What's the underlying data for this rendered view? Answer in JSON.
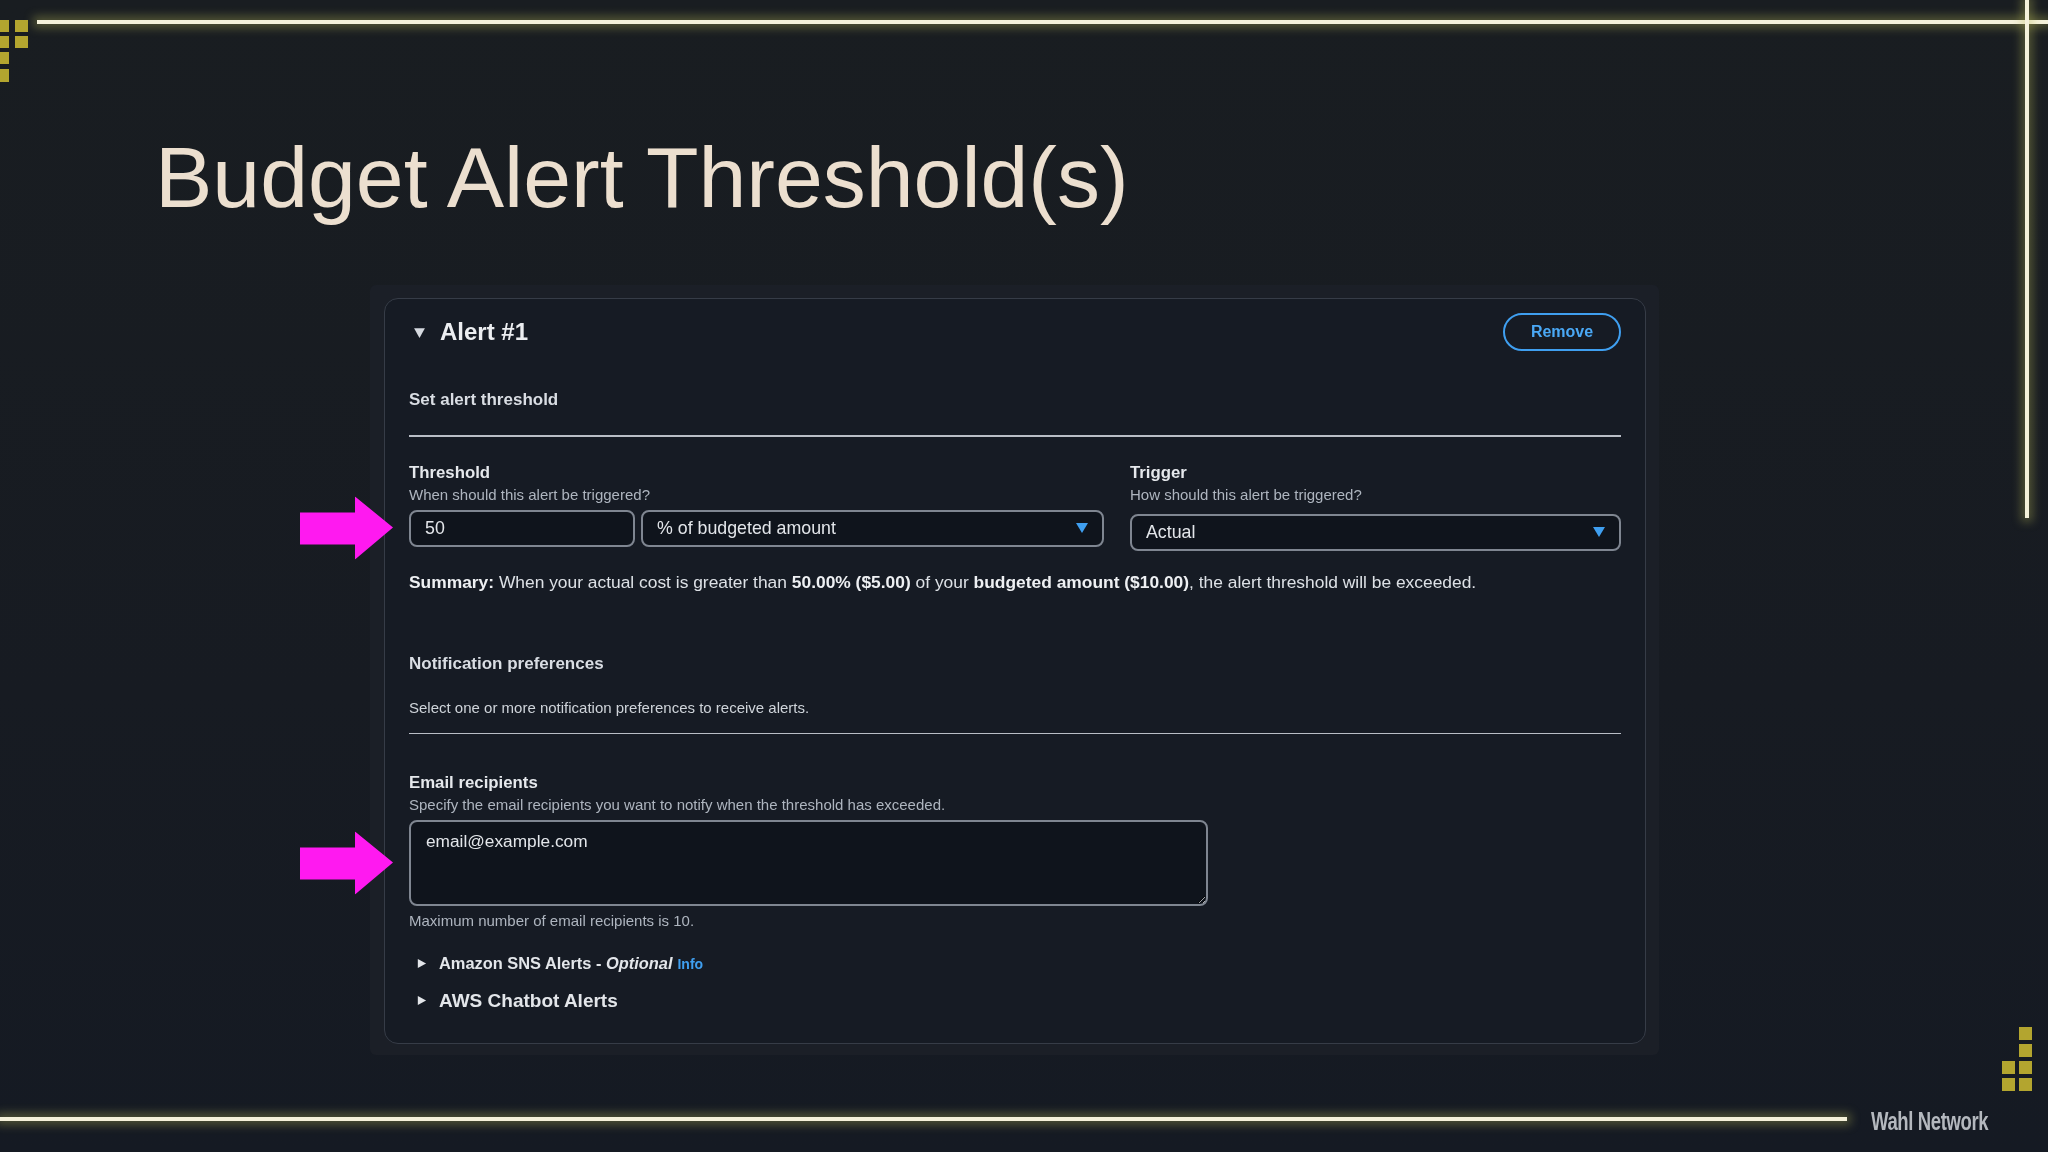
{
  "slide": {
    "title": "Budget Alert Threshold(s)",
    "footer_brand": "Wahl Network"
  },
  "alert": {
    "title": "Alert #1",
    "expanded": true,
    "remove_button": "Remove",
    "section_title": "Set alert threshold",
    "threshold": {
      "label": "Threshold",
      "description": "When should this alert be triggered?",
      "value": "50",
      "unit": "% of budgeted amount",
      "marked": true
    },
    "trigger": {
      "label": "Trigger",
      "description": "How should this alert be triggered?",
      "value": "Actual"
    },
    "summary": "**Summary:** When your actual cost is greater than **50.00% ($5.00)** of your **budgeted amount ($10.00)**, the alert threshold will be exceeded.",
    "notification": {
      "title": "Notification preferences",
      "description": "Select one or more notification preferences to receive alerts."
    },
    "email": {
      "label": "Email recipients",
      "description": "Specify the email recipients you want to notify when the threshold has exceeded.",
      "value": "email@example.com",
      "constraint": "Maximum number of email recipients is 10.",
      "marked": true
    },
    "expanders": [
      {
        "label": "Amazon SNS Alerts - *Optional*",
        "info_link": "Info",
        "expanded": false
      },
      {
        "label": "AWS Chatbot Alerts",
        "expanded": false
      }
    ]
  }
}
